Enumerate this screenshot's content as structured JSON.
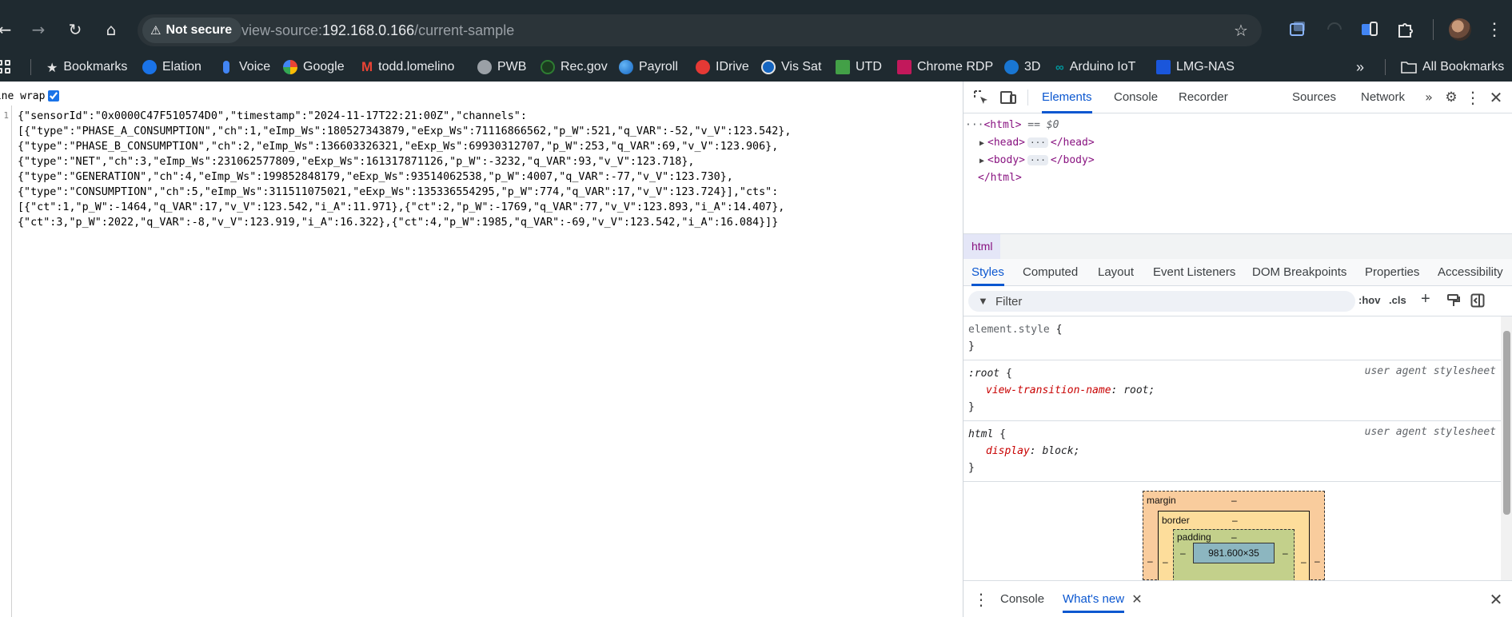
{
  "browser": {
    "security_label": "Not secure",
    "url_scheme": "view-source:",
    "url_host": "192.168.0.166",
    "url_path": "/current-sample"
  },
  "bookmarks": {
    "items": [
      {
        "label": "Bookmarks",
        "icon": "star-icon",
        "color": "#e3e3e3"
      },
      {
        "label": "Elation",
        "icon": "elation-icon",
        "color": "#1a73e8"
      },
      {
        "label": "Voice",
        "icon": "voice-icon",
        "color": "#4285f4"
      },
      {
        "label": "Google",
        "icon": "google-icon",
        "color": "#ffffff"
      },
      {
        "label": "todd.lomelino",
        "icon": "gmail-icon",
        "color": "#ea4335"
      },
      {
        "label": "PWB",
        "icon": "globe-icon",
        "color": "#9aa0a6"
      },
      {
        "label": "Rec.gov",
        "icon": "recgov-icon",
        "color": "#2e7d32"
      },
      {
        "label": "Payroll",
        "icon": "payroll-icon",
        "color": "#1e88e5"
      },
      {
        "label": "IDrive",
        "icon": "idrive-icon",
        "color": "#e53935"
      },
      {
        "label": "Vis Sat",
        "icon": "noaa-icon",
        "color": "#1565c0"
      },
      {
        "label": "UTD",
        "icon": "utd-icon",
        "color": "#43a047"
      },
      {
        "label": "Chrome RDP",
        "icon": "chrome-rdp-icon",
        "color": "#c2185b"
      },
      {
        "label": "3D",
        "icon": "3d-icon",
        "color": "#1976d2"
      },
      {
        "label": "Arduino IoT",
        "icon": "arduino-icon",
        "color": "#00979d"
      },
      {
        "label": "LMG-NAS",
        "icon": "dsm-icon",
        "color": "#1a56db"
      }
    ],
    "all_bookmarks_label": "All Bookmarks"
  },
  "source_view": {
    "line_wrap_label": "Line wrap",
    "line_number": "1",
    "content": "{\"sensorId\":\"0x0000C47F510574D0\",\"timestamp\":\"2024-11-17T22:21:00Z\",\"channels\":\n[{\"type\":\"PHASE_A_CONSUMPTION\",\"ch\":1,\"eImp_Ws\":180527343879,\"eExp_Ws\":71116866562,\"p_W\":521,\"q_VAR\":-52,\"v_V\":123.542},\n{\"type\":\"PHASE_B_CONSUMPTION\",\"ch\":2,\"eImp_Ws\":136603326321,\"eExp_Ws\":69930312707,\"p_W\":253,\"q_VAR\":69,\"v_V\":123.906},\n{\"type\":\"NET\",\"ch\":3,\"eImp_Ws\":231062577809,\"eExp_Ws\":161317871126,\"p_W\":-3232,\"q_VAR\":93,\"v_V\":123.718},\n{\"type\":\"GENERATION\",\"ch\":4,\"eImp_Ws\":199852848179,\"eExp_Ws\":93514062538,\"p_W\":4007,\"q_VAR\":-77,\"v_V\":123.730},\n{\"type\":\"CONSUMPTION\",\"ch\":5,\"eImp_Ws\":311511075021,\"eExp_Ws\":135336554295,\"p_W\":774,\"q_VAR\":17,\"v_V\":123.724}],\"cts\":\n[{\"ct\":1,\"p_W\":-1464,\"q_VAR\":17,\"v_V\":123.542,\"i_A\":11.971},{\"ct\":2,\"p_W\":-1769,\"q_VAR\":77,\"v_V\":123.893,\"i_A\":14.407},\n{\"ct\":3,\"p_W\":2022,\"q_VAR\":-8,\"v_V\":123.919,\"i_A\":16.322},{\"ct\":4,\"p_W\":1985,\"q_VAR\":-69,\"v_V\":123.542,\"i_A\":16.084}]}"
  },
  "devtools": {
    "tabs": [
      "Elements",
      "Console",
      "Recorder",
      "Sources",
      "Network"
    ],
    "dom": {
      "html_open": "<html>",
      "selected_marker": "== $0",
      "head_open": "<head>",
      "head_close": "</head>",
      "body_open": "<body>",
      "body_close": "</body>",
      "html_close": "</html>",
      "ellipsis": "···"
    },
    "breadcrumb": "html",
    "sub_tabs": [
      "Styles",
      "Computed",
      "Layout",
      "Event Listeners",
      "DOM Breakpoints",
      "Properties",
      "Accessibility"
    ],
    "filter_placeholder": "Filter",
    "hov_label": ":hov",
    "cls_label": ".cls",
    "rules": {
      "element_style": "element.style",
      "root_selector": ":root",
      "root_origin": "user agent stylesheet",
      "root_prop": "view-transition-name",
      "root_val": "root",
      "html_selector": "html",
      "html_origin": "user agent stylesheet",
      "html_prop": "display",
      "html_val": "block"
    },
    "box_model": {
      "margin_label": "margin",
      "border_label": "border",
      "padding_label": "padding",
      "dash": "–",
      "content_size": "981.600×35"
    },
    "drawer_tabs": [
      "Console",
      "What's new"
    ]
  }
}
